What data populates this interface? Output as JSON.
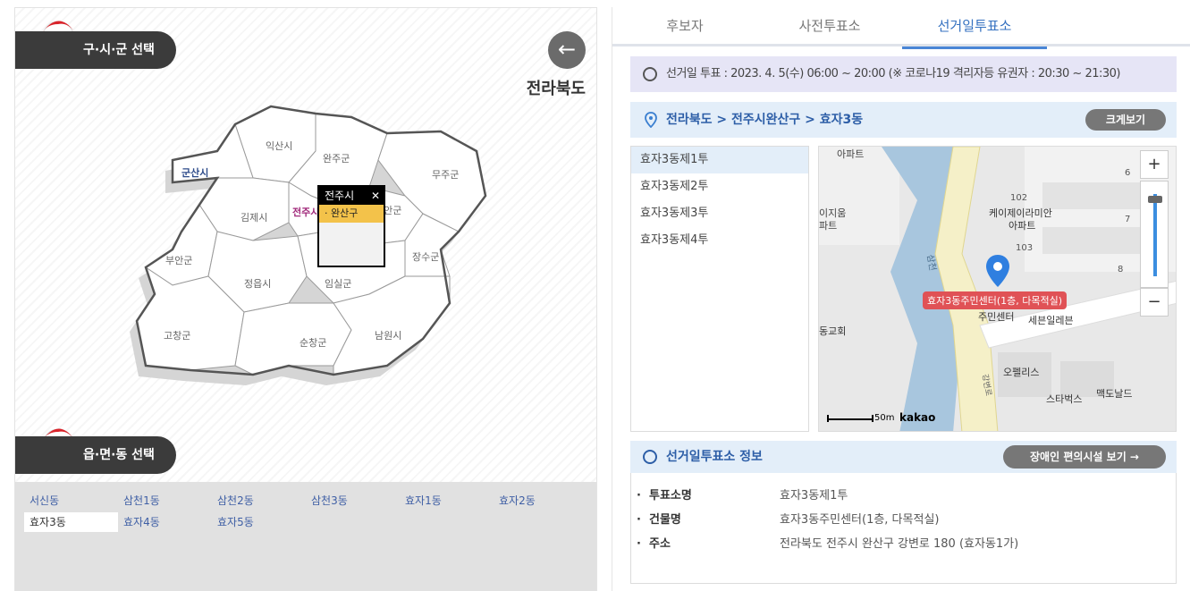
{
  "left": {
    "city_select_label": "구·시·군 선택",
    "dong_select_label": "읍·면·동 선택",
    "back_label": "←",
    "province": "전라북도",
    "regions": [
      "익산시",
      "완주군",
      "무주군",
      "군산시",
      "김제시",
      "전주시",
      "진안군",
      "부안군",
      "장수군",
      "정읍시",
      "임실군",
      "고창군",
      "순창군",
      "남원시"
    ],
    "popup": {
      "title": "전주시",
      "close": "✕",
      "item": "· 완산구"
    },
    "dongs": [
      "서신동",
      "삼천1동",
      "삼천2동",
      "삼천3동",
      "효자1동",
      "효자2동",
      "효자3동",
      "효자4동",
      "효자5동"
    ],
    "selected_dong": "효자3동"
  },
  "tabs": [
    "후보자",
    "사전투표소",
    "선거일투표소"
  ],
  "active_tab": "선거일투표소",
  "notice": "선거일 투표 : 2023. 4. 5(수) 06:00 ~ 20:00  (※ 코로나19 격리자등 유권자 : 20:30 ~ 21:30)",
  "location": {
    "breadcrumb": "전라북도 > 전주시완산구 > 효자3동",
    "zoom_label": "크게보기"
  },
  "polls": [
    "효자3동제1투",
    "효자3동제2투",
    "효자3동제3투",
    "효자3동제4투"
  ],
  "selected_poll": "효자3동제1투",
  "map": {
    "marker_label": "효자3동주민센터(1층, 다목적실)",
    "labels": [
      "아파트",
      "이지움",
      "파트",
      "케이제이라미안",
      "아파트",
      "102",
      "103",
      "6",
      "7",
      "8",
      "주민센터",
      "세븐일레븐",
      "동교회",
      "오펠리스",
      "스타벅스",
      "맥도날드",
      "삼천",
      "강변로"
    ],
    "scale_label": "50m",
    "brand": "kakao",
    "zoom_in": "+",
    "zoom_out": "−"
  },
  "info": {
    "title": "선거일투표소 정보",
    "facility_btn": "장애인 편의시설 보기  →",
    "rows": [
      {
        "label": "투표소명",
        "value": "효자3동제1투"
      },
      {
        "label": "건물명",
        "value": "효자3동주민센터(1층, 다목적실)"
      },
      {
        "label": "주소",
        "value": "전라북도 전주시 완산구 강변로 180 (효자동1가)"
      }
    ]
  }
}
